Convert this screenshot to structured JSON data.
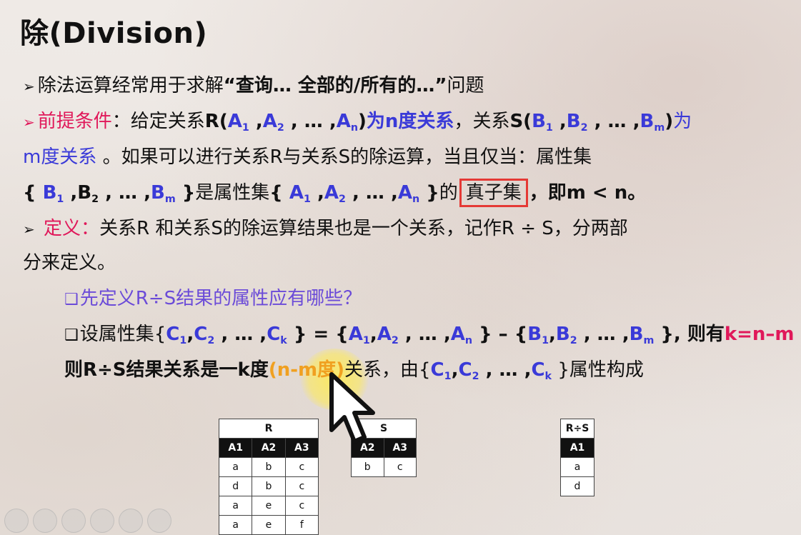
{
  "title": "除(Division)",
  "line1": {
    "text": "除法运算经常用于求解",
    "bold": "“查询… 全部的/所有的…”",
    "tail": "问题"
  },
  "line2": {
    "label": "前提条件",
    "p1": "：给定关系",
    "R": "R(",
    "A": "A",
    "sub1": "1",
    "sub2": "2",
    "subn": "n",
    "sep": " ,",
    "dots": " , … ,",
    "close": ")",
    "p2": "为n度关系",
    "p3": "，关系",
    "S": "S(",
    "B": "B",
    "subm": "m",
    "p4": "为"
  },
  "line3": {
    "m": "m度关系",
    "rest": " 。如果可以进行关系R与关系S的除运算，当且仅当：属性集"
  },
  "line4": {
    "open": "{ ",
    "close": " }",
    "p1": "是属性集",
    "p2": "的",
    "boxed": "真子集",
    "p3": "，即m < n。"
  },
  "line5": {
    "label": "定义",
    "colon": "：",
    "rest": "关系R 和关系S的除运算结果也是一个关系，记作R ÷ S，分两部"
  },
  "line6": {
    "text": "分来定义。"
  },
  "line7": {
    "text": "先定义R÷S结果的属性应有哪些？"
  },
  "line8": {
    "p1": "设属性集{",
    "C": "C",
    "subk": "k",
    "p2": " } = {",
    "p3": " } – {",
    "p4": " }, 则有",
    "keq": "k=n–m"
  },
  "line9": {
    "p1": "则R÷S结果关系是一k度",
    "orange": "(n-m度)",
    "p2": "关系，由{",
    "p3": " }属性构成"
  },
  "table_r": {
    "caption": "R",
    "headers": [
      "A1",
      "A2",
      "A3"
    ],
    "rows": [
      [
        "a",
        "b",
        "c"
      ],
      [
        "d",
        "b",
        "c"
      ],
      [
        "a",
        "e",
        "c"
      ],
      [
        "a",
        "e",
        "f"
      ]
    ]
  },
  "table_s": {
    "caption": "S",
    "headers": [
      "A2",
      "A3"
    ],
    "rows": [
      [
        "b",
        "c"
      ]
    ]
  },
  "table_rs": {
    "caption": "R÷S",
    "headers": [
      "A1"
    ],
    "rows": [
      [
        "a"
      ],
      [
        "d"
      ]
    ]
  },
  "colors": {
    "blue": "#3a3ad8",
    "red": "#e0185a",
    "orange": "#f0a020",
    "box": "#e53935"
  }
}
